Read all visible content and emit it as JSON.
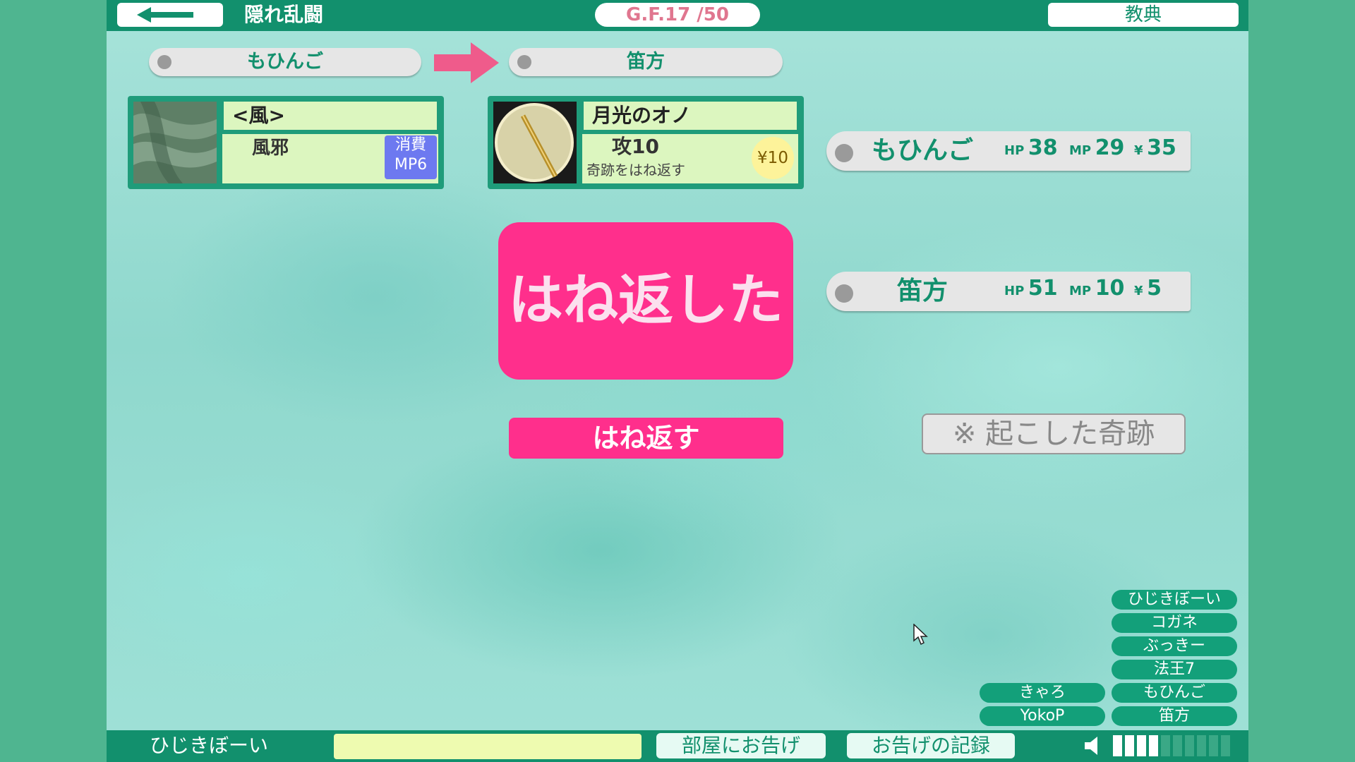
{
  "header": {
    "back_icon": "arrow-left-icon",
    "title": "隠れ乱闘",
    "turn_counter": "G.F.17 /50",
    "codex_label": "教典"
  },
  "turn_flow": {
    "attacker": "もひんご",
    "defender": "笛方",
    "arrow_icon": "arrow-right-icon"
  },
  "attack_card": {
    "name": "<風>",
    "effect": "風邪",
    "cost_line1": "消費",
    "cost_line2": "MP6",
    "image_icon": "wind-texture-icon"
  },
  "defense_card": {
    "name": "月光のオノ",
    "stat": "攻10",
    "desc": "奇跡をはね返す",
    "price": "¥10",
    "image_icon": "moon-axe-icon"
  },
  "result": {
    "main_text": "はね返した",
    "action_label": "はね返す"
  },
  "players": [
    {
      "name": "もひんご",
      "hp_label": "HP",
      "hp": "38",
      "mp_label": "MP",
      "mp": "29",
      "money_label": "¥",
      "money": "35"
    },
    {
      "name": "笛方",
      "hp_label": "HP",
      "hp": "51",
      "mp_label": "MP",
      "mp": "10",
      "money_label": "¥",
      "money": "5"
    }
  ],
  "miracle_button": "※ 起こした奇跡",
  "player_list": {
    "left_column": [
      "きゃろ",
      "YokoP"
    ],
    "right_column": [
      "ひじきぼーい",
      "コガネ",
      "ぶっきー",
      "法王7",
      "もひんご",
      "笛方"
    ]
  },
  "footer": {
    "user_name": "ひじきぼーい",
    "chat_value": "",
    "announce_button": "部屋にお告げ",
    "log_button": "お告げの記録",
    "speaker_icon": "speaker-icon",
    "volume_level": 0.4,
    "volume_steps": 10
  },
  "colors": {
    "primary": "#12906d",
    "accent_pink": "#ff2f8c",
    "card_bg": "#dcf6bf",
    "cost_badge": "#6d79f0"
  }
}
